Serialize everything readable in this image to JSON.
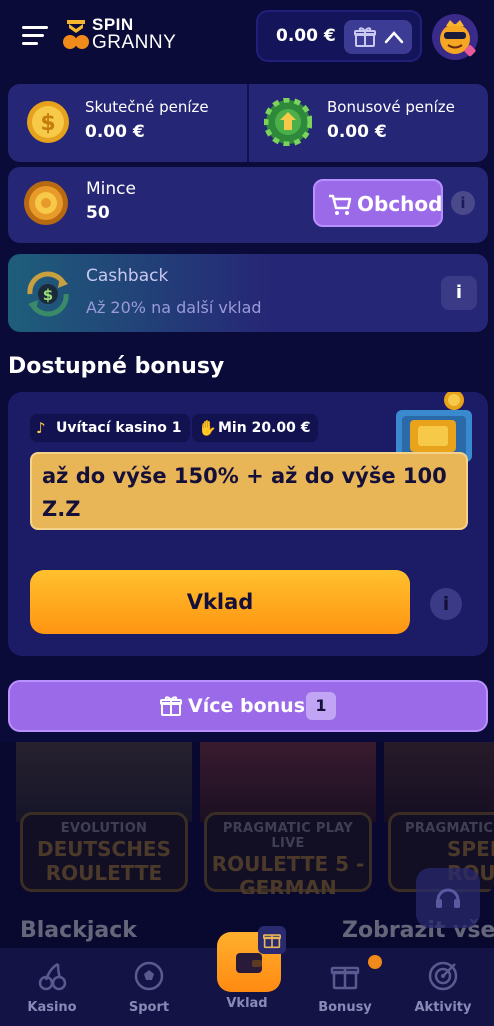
{
  "header": {
    "logo": {
      "line1": "SPIN",
      "line2": "GRANNY"
    },
    "balance": "0.00 €",
    "icons": {
      "menu": "hamburger-icon",
      "gift": "gift-icon",
      "chevron": "chevron-up-icon",
      "avatar": "granny-avatar-icon"
    }
  },
  "wallet": {
    "real": {
      "label": "Skutečné peníze",
      "value": "0.00 €",
      "icon": "dollar-coin-icon"
    },
    "bonus": {
      "label": "Bonusové peníze",
      "value": "0.00 €",
      "icon": "bonus-chip-icon"
    }
  },
  "coins": {
    "label": "Mince",
    "value": "50",
    "shop_label": "Obchod",
    "info": "i"
  },
  "cashback": {
    "title": "Cashback",
    "subtitle": "Až 20% na další vklad",
    "info": "i"
  },
  "bonuses": {
    "section_title": "Dostupné bonusy",
    "tag_welcome": "Uvítací kasino 1",
    "tag_min": "Min 20.00 €",
    "offer": "až do výše 150% + až do výše 100 Z.Z",
    "deposit_label": "Vklad",
    "info": "i",
    "more_label": "Více bonusů",
    "more_count": "1"
  },
  "games": {
    "tiles": [
      {
        "provider": "EVOLUTION",
        "name_l1": "DEUTSCHES",
        "name_l2": "ROULETTE"
      },
      {
        "provider": "PRAGMATIC PLAY LIVE",
        "name_l1": "ROULETTE 5 -",
        "name_l2": "GERMAN"
      },
      {
        "provider": "PRAGMATIC PL",
        "name_l1": "SPEE",
        "name_l2": "ROUL"
      }
    ],
    "next_section": "Blackjack",
    "show_all": "Zobrazit vše"
  },
  "nav": {
    "items": [
      {
        "label": "Kasino",
        "icon": "cherry-icon"
      },
      {
        "label": "Sport",
        "icon": "soccer-ball-icon"
      },
      {
        "label": "Vklad",
        "icon": "wallet-icon"
      },
      {
        "label": "Bonusy",
        "icon": "gift-icon"
      },
      {
        "label": "Aktivity",
        "icon": "target-icon"
      }
    ]
  },
  "colors": {
    "background": "#0b0b3a",
    "card": "#262676",
    "purple_button": "#9b6ae8",
    "orange_button": "#ff9f1c",
    "offer_bg": "#e8b557"
  }
}
